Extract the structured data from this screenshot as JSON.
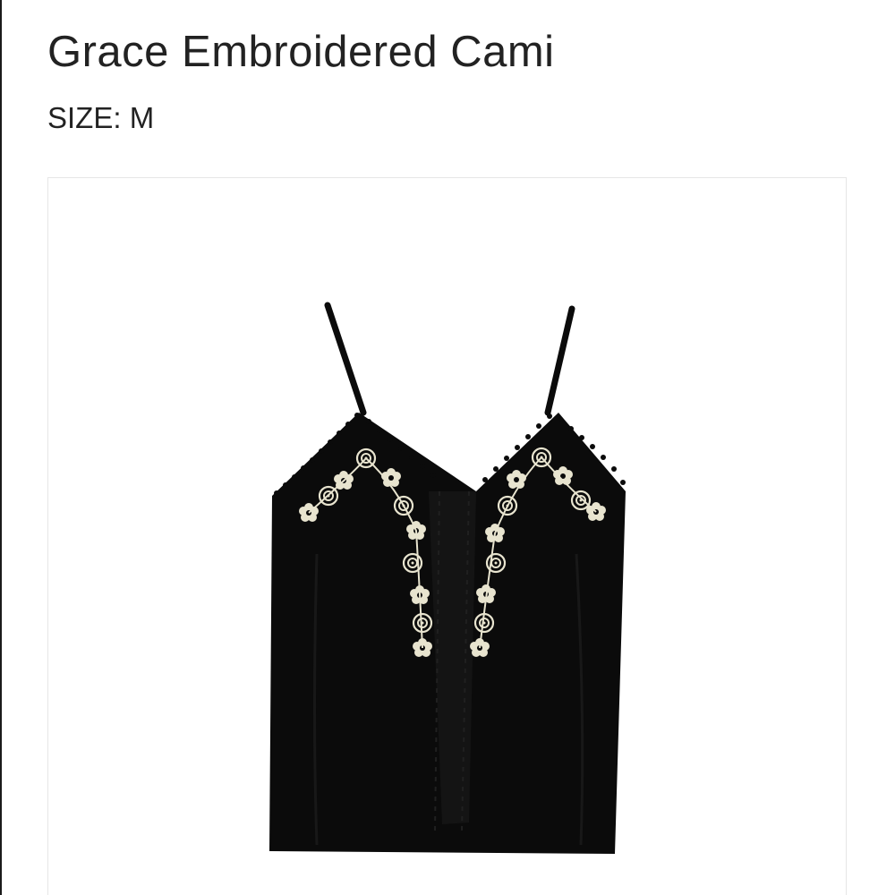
{
  "product": {
    "name": "Grace Embroidered Cami",
    "size_label": "SIZE:",
    "size_value": "M"
  },
  "image": {
    "subject": "camisole-photo",
    "garment_color": "#0b0b0b",
    "embroidery_color": "#e8e4cf"
  }
}
